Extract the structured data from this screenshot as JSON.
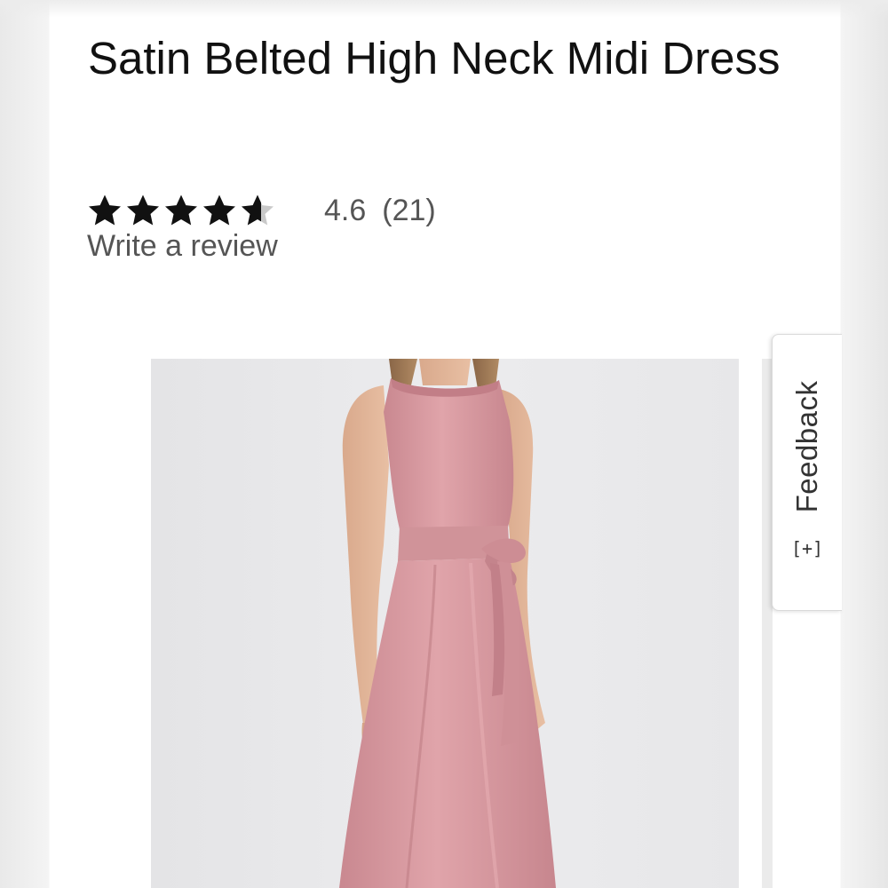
{
  "product": {
    "title": "Satin Belted High Neck Midi Dress",
    "rating": {
      "value": "4.6",
      "count": "(21)",
      "stars_filled": 4.6,
      "stars_total": 5,
      "write_review_label": "Write a review"
    },
    "image": {
      "subject": "model wearing dusty pink satin sleeveless midi dress with tie belt"
    }
  },
  "feedback_tab": {
    "label": "Feedback",
    "icon_glyph": "[+]"
  },
  "colors": {
    "title": "#111111",
    "meta_text": "#555555",
    "star": "#111111",
    "dress": "#d3939a",
    "image_bg": "#e9e9eb"
  }
}
